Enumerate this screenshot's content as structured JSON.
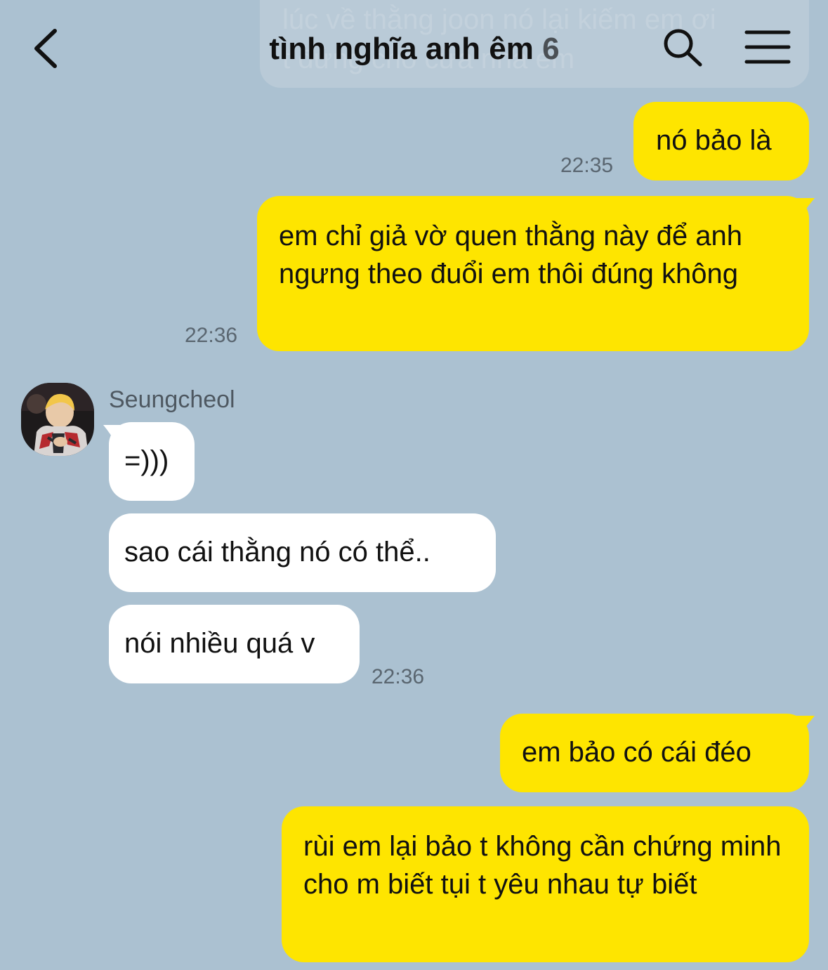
{
  "header": {
    "title": "tình nghĩa anh êm",
    "member_count": "6"
  },
  "background_snippet": {
    "line1": "lúc về thằng joon nó lại kiếm em ơi",
    "line2": "t đứng chỗ cửa nhà em"
  },
  "messages": [
    {
      "side": "mine",
      "text": "nó bảo là",
      "time": "22:35"
    },
    {
      "side": "mine",
      "text": "em chỉ giả vờ quen thằng này để anh ngưng theo đuổi em thôi đúng không",
      "time": "22:36"
    },
    {
      "side": "theirs",
      "sender": "Seungcheol",
      "text": "=)))"
    },
    {
      "side": "theirs",
      "text": "sao cái thằng nó có thể.."
    },
    {
      "side": "theirs",
      "text": "nói nhiều quá v",
      "time": "22:36"
    },
    {
      "side": "mine",
      "text": "em bảo có cái đéo"
    },
    {
      "side": "mine",
      "text": "rùi em lại bảo t không cần chứng minh cho m biết tụi t yêu nhau tự biết"
    }
  ],
  "icons": {
    "back": "chevron-left-icon",
    "search": "search-icon",
    "menu": "hamburger-menu-icon",
    "avatar": "avatar-photo"
  },
  "colors": {
    "background": "#abc1d1",
    "my_bubble": "#fee500",
    "their_bubble": "#ffffff"
  }
}
